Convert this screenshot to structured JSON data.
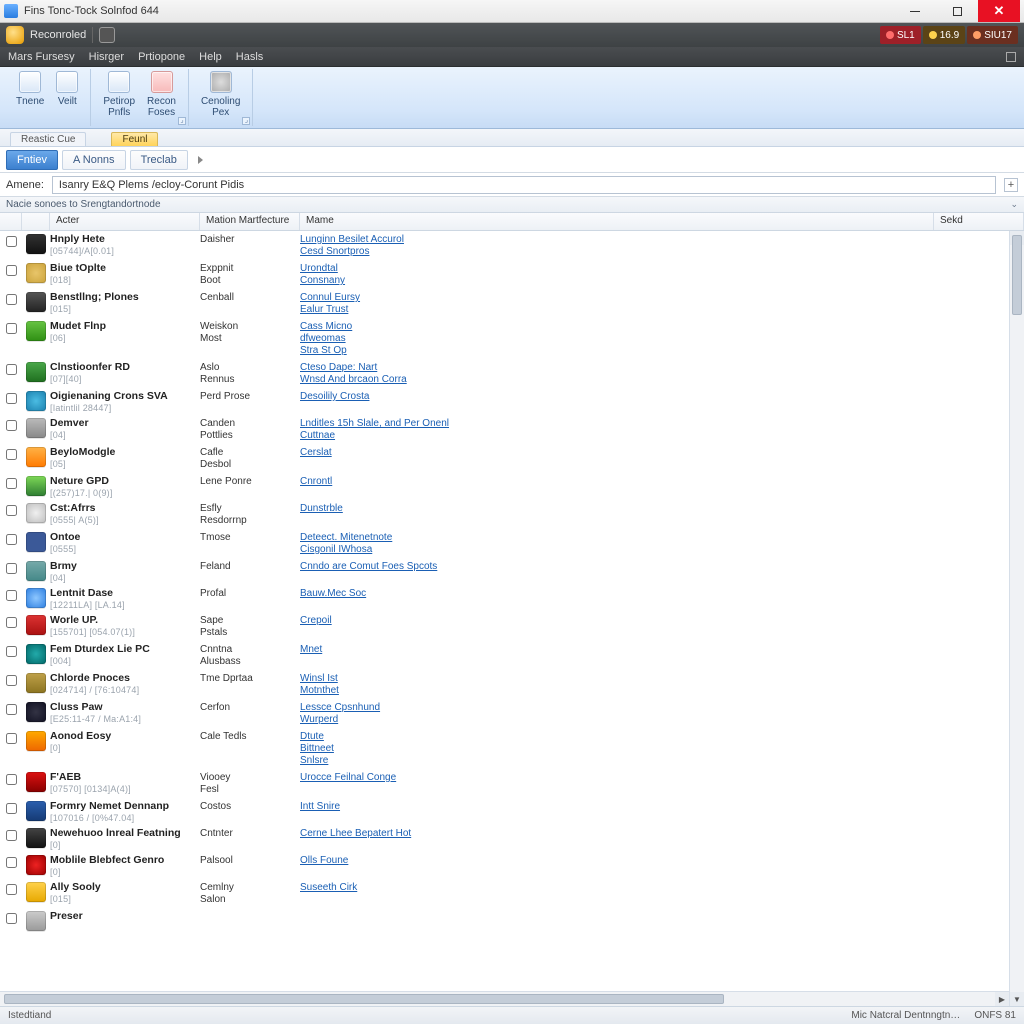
{
  "titlebar": {
    "title": "Fins Tonc-Tock Solnfod 644"
  },
  "recbar": {
    "label": "Reconroled"
  },
  "badges": [
    {
      "text": "SL1"
    },
    {
      "text": "16.9"
    },
    {
      "text": "SIU17"
    }
  ],
  "menu": {
    "items": [
      "Mars Fursesy",
      "Hisrger",
      "Prtiopone",
      "Help",
      "Hasls"
    ]
  },
  "ribbon": {
    "groups": [
      {
        "items": [
          {
            "l1": "Tnene",
            "l2": ""
          },
          {
            "l1": "Veilt",
            "l2": ""
          }
        ]
      },
      {
        "items": [
          {
            "l1": "Petirop",
            "l2": "Pnfls"
          },
          {
            "l1": "Recon",
            "l2": "Foses"
          }
        ]
      },
      {
        "items": [
          {
            "l1": "Cenoling",
            "l2": "Pex"
          }
        ]
      }
    ]
  },
  "doctabs": {
    "items": [
      {
        "label": "Reastic Cue",
        "active": false
      },
      {
        "label": "Feunl",
        "active": true
      }
    ]
  },
  "subtabs": {
    "items": [
      {
        "label": "Fntiev",
        "primary": true
      },
      {
        "label": "A Nonns",
        "primary": false
      },
      {
        "label": "Treclab",
        "primary": false
      }
    ]
  },
  "path": {
    "label": "Amene:",
    "value": "Isanry E&Q Plems /ecloy-Corunt Pidis"
  },
  "infostrip": "Nacie sonoes to Srengtandortnode",
  "columns": {
    "name": "Acter",
    "mfr": "Mation Martfecture",
    "more": "Mame",
    "sel": "Sekd"
  },
  "rows": [
    {
      "name": "Hnply Hete",
      "sub": "[05744]/A[0.01]",
      "mfr": "Daisher",
      "links": [
        "Lunginn Besilet Accurol",
        "Cesd Snortpros"
      ]
    },
    {
      "name": "Biue tOplte",
      "sub": "[018]",
      "mfr": "Exppnit Boot",
      "links": [
        "Urondtal",
        "Consnany"
      ]
    },
    {
      "name": "Benstllng; Plones",
      "sub": "[015]",
      "mfr": "Cenball",
      "links": [
        "Connul Eursy",
        "Ealur Trust"
      ]
    },
    {
      "name": "Mudet Flnp",
      "sub": "[06]",
      "mfr": "Weiskon Most",
      "links": [
        "Cass Micno",
        "dfweomas",
        "Stra St Op"
      ]
    },
    {
      "name": "Clnstioonfer RD",
      "sub": "[07][40]",
      "mfr": "Aslo Rennus",
      "links": [
        "Cteso Dape: Nart",
        "Wnsd And brcaon Corra"
      ]
    },
    {
      "name": "Oigienaning Crons SVA",
      "sub": "[Iatintlil 28447]",
      "mfr": "Perd Prose",
      "links": [
        "Desoilily Crosta"
      ]
    },
    {
      "name": "Demver",
      "sub": "[04]",
      "mfr": "Canden Pottlies",
      "links": [
        "Lnditles 15h Slale, and Per Onenl",
        "Cuttnae"
      ]
    },
    {
      "name": "BeyloModgle",
      "sub": "[05]",
      "mfr": "Cafle Desbol",
      "links": [
        "Cerslat"
      ]
    },
    {
      "name": "Neture GPD",
      "sub": "[(257)17.| 0(9)]",
      "mfr": "Lene Ponre",
      "links": [
        "Cnrontl"
      ]
    },
    {
      "name": "Cst:Afrrs",
      "sub": "[0555| A(5)]",
      "mfr": "Esfly Resdorrnp",
      "links": [
        "Dunstrble"
      ]
    },
    {
      "name": "Ontoe",
      "sub": "[0555]",
      "mfr": "Tmose",
      "links": [
        "Deteect. Mitenetnote",
        "Cisgonil IWhosa"
      ]
    },
    {
      "name": "Brmy",
      "sub": "[04]",
      "mfr": "Feland",
      "links": [
        "Cnndo are Comut Foes Spcots"
      ]
    },
    {
      "name": "Lentnit Dase",
      "sub": "[12211LA] [LA.14]",
      "mfr": "Profal",
      "links": [
        "Bauw.Mec Soc"
      ]
    },
    {
      "name": "Worle UP.",
      "sub": "[155701] [054.07(1)]",
      "mfr": "Sape Pstals",
      "links": [
        "Crepoil"
      ]
    },
    {
      "name": "Fem Dturdex Lie PC",
      "sub": "[004]",
      "mfr": "Cnntna Alusbass",
      "links": [
        "Mnet"
      ]
    },
    {
      "name": "Chlorde Pnoces",
      "sub": "[024714] / [76:10474]",
      "mfr": "Tme Dprtaa",
      "links": [
        "Winsl Ist",
        "Motnthet"
      ]
    },
    {
      "name": "Cluss Paw",
      "sub": "[E25:11-47 / Ma:A1:4]",
      "mfr": "Cerfon",
      "links": [
        "Lessce Cpsnhund",
        "Wurperd"
      ]
    },
    {
      "name": "Aonod Eosy",
      "sub": "[0]",
      "mfr": "Cale Tedls",
      "links": [
        "Dtute",
        "Bittneet",
        "Snlsre"
      ]
    },
    {
      "name": "F'AEB",
      "sub": "[07570] [0134]A(4)]",
      "mfr": "Viooey Fesl",
      "links": [
        "Urocce Feilnal Conge"
      ]
    },
    {
      "name": "Formry Nemet Dennanp",
      "sub": "[107016 / [0%47.04]",
      "mfr": "Costos",
      "links": [
        "Intt Snire"
      ]
    },
    {
      "name": "Newehuoo lnreal Featning",
      "sub": "[0]",
      "mfr": "Cntnter",
      "links": [
        "Cerne Lhee Bepatert Hot"
      ]
    },
    {
      "name": "Moblile Blebfect Genro",
      "sub": "[0]",
      "mfr": "Palsool",
      "links": [
        "Olls Foune"
      ]
    },
    {
      "name": "Ally Sooly",
      "sub": "[015]",
      "mfr": "Cemlny Salon",
      "links": [
        "Suseeth Cirk"
      ]
    },
    {
      "name": "Preser",
      "sub": "",
      "mfr": "",
      "links": []
    }
  ],
  "status": {
    "left": "Istedtiand",
    "right": [
      "Mic Natcral Dentnngtn…",
      "ONFS  81"
    ]
  }
}
